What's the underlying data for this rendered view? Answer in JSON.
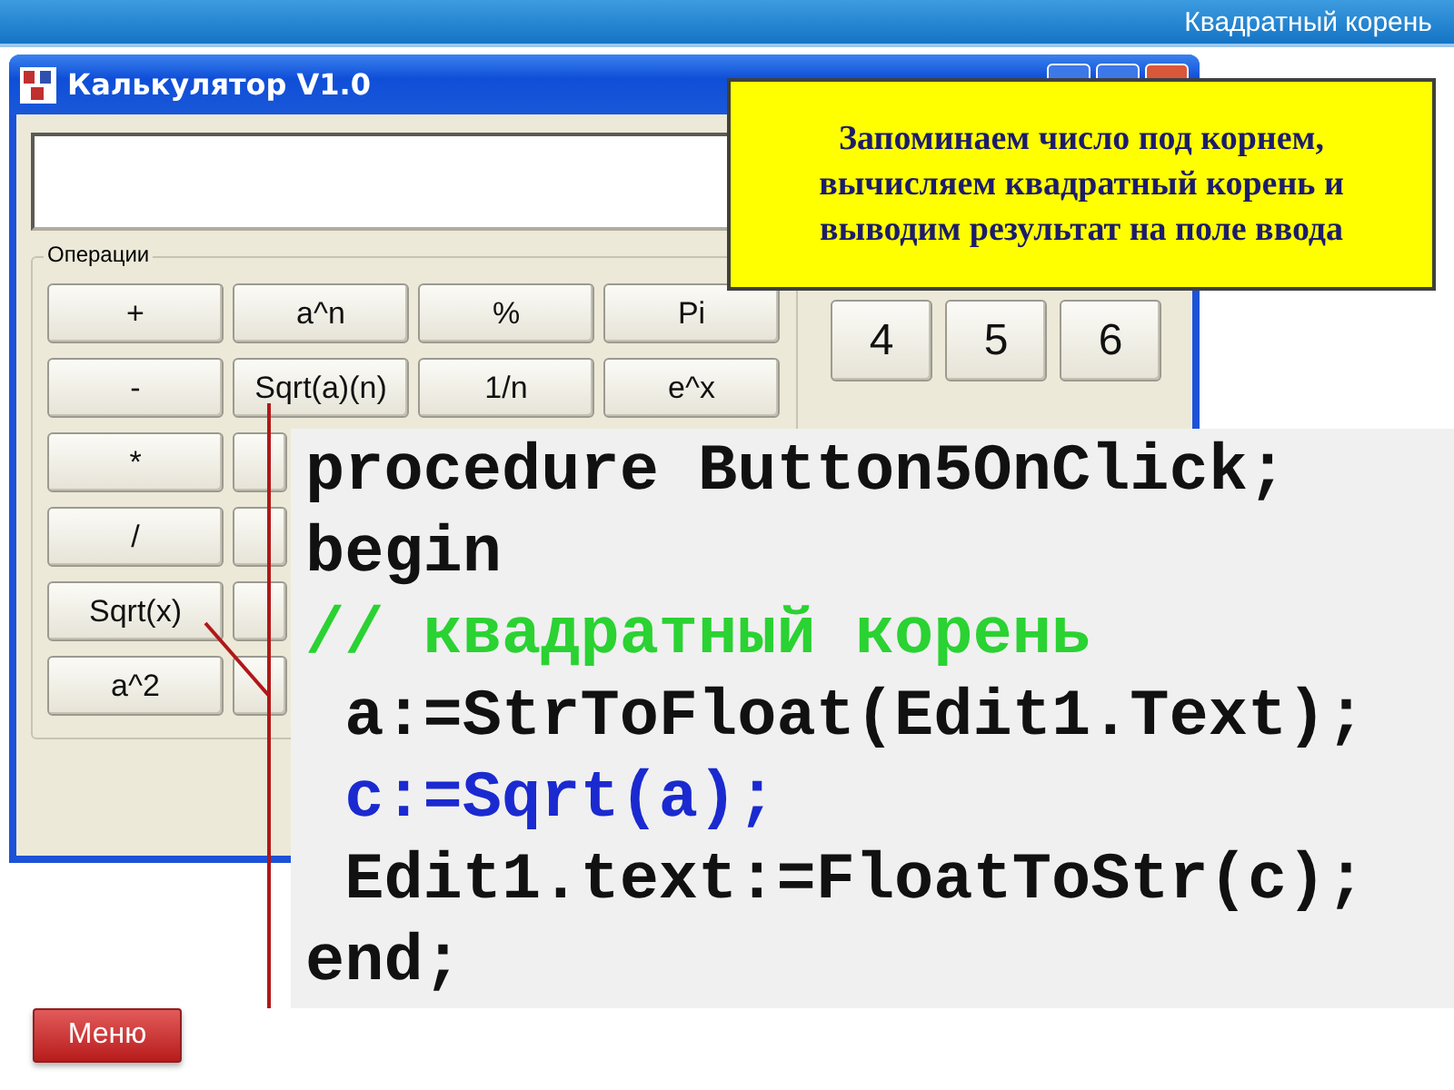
{
  "slide": {
    "title": "Квадратный корень"
  },
  "window": {
    "title": "Калькулятор V1.0"
  },
  "operations": {
    "label": "Операции",
    "rows": [
      [
        "+",
        "a^n",
        "%",
        "Pi"
      ],
      [
        "-",
        "Sqrt(a)(n)",
        "1/n",
        "e^x"
      ],
      [
        "*"
      ],
      [
        "/"
      ],
      [
        "Sqrt(x)"
      ],
      [
        "a^2"
      ]
    ]
  },
  "digits": [
    "4",
    "5",
    "6"
  ],
  "callout": {
    "text": "Запоминаем число под корнем, вычисляем квадратный корень и выводим результат на поле ввода"
  },
  "code": {
    "lines": [
      {
        "text": "procedure Button5OnClick;",
        "kind": "plain"
      },
      {
        "text": "begin",
        "kind": "plain"
      },
      {
        "text": "// квадратный корень",
        "kind": "comment"
      },
      {
        "text": " a:=StrToFloat(Edit1.Text);",
        "kind": "plain"
      },
      {
        "text": " c:=Sqrt(a);",
        "kind": "call"
      },
      {
        "text": " Edit1.text:=FloatToStr(c);",
        "kind": "plain"
      },
      {
        "text": "end;",
        "kind": "plain"
      }
    ]
  },
  "menu_button": {
    "label": "Меню"
  }
}
